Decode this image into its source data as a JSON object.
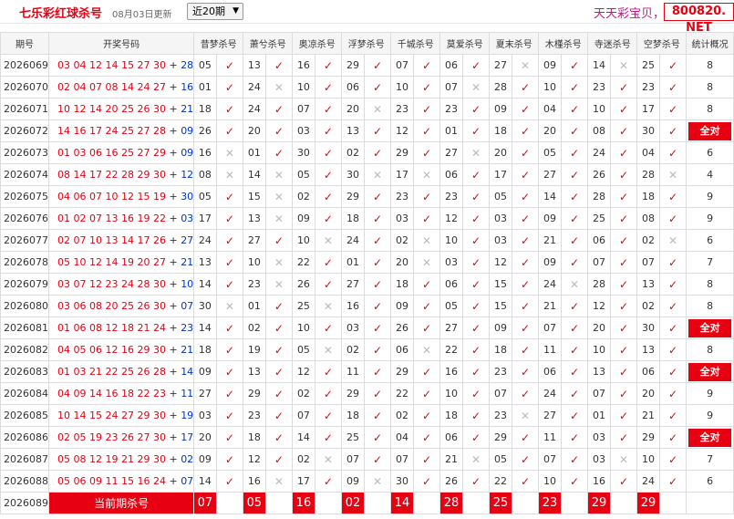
{
  "header": {
    "app_title": "七乐彩红球杀号",
    "date": "08月03日更新",
    "period_select": "近20期",
    "slogan": "天天彩宝贝，天",
    "site_badge": "800820. NET"
  },
  "columns": {
    "period": "期号",
    "draw": "开奖号码",
    "experts": [
      "昔梦杀号",
      "萧兮杀号",
      "奥凉杀号",
      "浮梦杀号",
      "千城杀号",
      "莫爱杀号",
      "夏末杀号",
      "木槿杀号",
      "寺迷杀号",
      "空梦杀号"
    ],
    "stat": "统计概况"
  },
  "rows": [
    {
      "period": "2026069",
      "red": "03 04 12 14 15 27 30",
      "blue": "28",
      "kills": [
        [
          "05",
          1
        ],
        [
          "13",
          1
        ],
        [
          "16",
          1
        ],
        [
          "29",
          1
        ],
        [
          "07",
          1
        ],
        [
          "06",
          1
        ],
        [
          "27",
          0
        ],
        [
          "09",
          1
        ],
        [
          "14",
          0
        ],
        [
          "25",
          1
        ]
      ],
      "stat": "8"
    },
    {
      "period": "2026070",
      "red": "02 04 07 08 14 24 27",
      "blue": "16",
      "kills": [
        [
          "01",
          1
        ],
        [
          "24",
          0
        ],
        [
          "10",
          1
        ],
        [
          "06",
          1
        ],
        [
          "10",
          1
        ],
        [
          "07",
          0
        ],
        [
          "28",
          1
        ],
        [
          "10",
          1
        ],
        [
          "23",
          1
        ],
        [
          "23",
          1
        ]
      ],
      "stat": "8"
    },
    {
      "period": "2026071",
      "red": "10 12 14 20 25 26 30",
      "blue": "21",
      "kills": [
        [
          "18",
          1
        ],
        [
          "24",
          1
        ],
        [
          "07",
          1
        ],
        [
          "20",
          0
        ],
        [
          "23",
          1
        ],
        [
          "23",
          1
        ],
        [
          "09",
          1
        ],
        [
          "04",
          1
        ],
        [
          "10",
          1
        ],
        [
          "17",
          1
        ]
      ],
      "stat": "8"
    },
    {
      "period": "2026072",
      "red": "14 16 17 24 25 27 28",
      "blue": "09",
      "kills": [
        [
          "26",
          1
        ],
        [
          "20",
          1
        ],
        [
          "03",
          1
        ],
        [
          "13",
          1
        ],
        [
          "12",
          1
        ],
        [
          "01",
          1
        ],
        [
          "18",
          1
        ],
        [
          "20",
          1
        ],
        [
          "08",
          1
        ],
        [
          "30",
          1
        ]
      ],
      "stat": "全对"
    },
    {
      "period": "2026073",
      "red": "01 03 06 16 25 27 29",
      "blue": "09",
      "kills": [
        [
          "16",
          0
        ],
        [
          "01",
          1
        ],
        [
          "30",
          1
        ],
        [
          "02",
          1
        ],
        [
          "29",
          1
        ],
        [
          "27",
          0
        ],
        [
          "20",
          1
        ],
        [
          "05",
          1
        ],
        [
          "24",
          1
        ],
        [
          "04",
          1
        ]
      ],
      "stat": "6"
    },
    {
      "period": "2026074",
      "red": "08 14 17 22 28 29 30",
      "blue": "12",
      "kills": [
        [
          "08",
          0
        ],
        [
          "14",
          0
        ],
        [
          "05",
          1
        ],
        [
          "30",
          0
        ],
        [
          "17",
          0
        ],
        [
          "06",
          1
        ],
        [
          "17",
          1
        ],
        [
          "27",
          1
        ],
        [
          "26",
          1
        ],
        [
          "28",
          0
        ]
      ],
      "stat": "4"
    },
    {
      "period": "2026075",
      "red": "04 06 07 10 12 15 19",
      "blue": "30",
      "kills": [
        [
          "05",
          1
        ],
        [
          "15",
          0
        ],
        [
          "02",
          1
        ],
        [
          "29",
          1
        ],
        [
          "23",
          1
        ],
        [
          "23",
          1
        ],
        [
          "05",
          1
        ],
        [
          "14",
          1
        ],
        [
          "28",
          1
        ],
        [
          "18",
          1
        ]
      ],
      "stat": "9"
    },
    {
      "period": "2026076",
      "red": "01 02 07 13 16 19 22",
      "blue": "03",
      "kills": [
        [
          "17",
          1
        ],
        [
          "13",
          0
        ],
        [
          "09",
          1
        ],
        [
          "18",
          1
        ],
        [
          "03",
          1
        ],
        [
          "12",
          1
        ],
        [
          "03",
          1
        ],
        [
          "09",
          1
        ],
        [
          "25",
          1
        ],
        [
          "08",
          1
        ]
      ],
      "stat": "9"
    },
    {
      "period": "2026077",
      "red": "02 07 10 13 14 17 26",
      "blue": "27",
      "kills": [
        [
          "24",
          1
        ],
        [
          "27",
          1
        ],
        [
          "10",
          0
        ],
        [
          "24",
          1
        ],
        [
          "02",
          0
        ],
        [
          "10",
          1
        ],
        [
          "03",
          1
        ],
        [
          "21",
          1
        ],
        [
          "06",
          1
        ],
        [
          "02",
          0
        ]
      ],
      "stat": "6"
    },
    {
      "period": "2026078",
      "red": "05 10 12 14 19 20 27",
      "blue": "21",
      "kills": [
        [
          "13",
          1
        ],
        [
          "10",
          0
        ],
        [
          "22",
          1
        ],
        [
          "01",
          1
        ],
        [
          "20",
          0
        ],
        [
          "03",
          1
        ],
        [
          "12",
          1
        ],
        [
          "09",
          1
        ],
        [
          "07",
          1
        ],
        [
          "07",
          1
        ]
      ],
      "stat": "7"
    },
    {
      "period": "2026079",
      "red": "03 07 12 23 24 28 30",
      "blue": "10",
      "kills": [
        [
          "14",
          1
        ],
        [
          "23",
          0
        ],
        [
          "26",
          1
        ],
        [
          "27",
          1
        ],
        [
          "18",
          1
        ],
        [
          "06",
          1
        ],
        [
          "15",
          1
        ],
        [
          "24",
          0
        ],
        [
          "28",
          1
        ],
        [
          "13",
          1
        ]
      ],
      "stat": "8"
    },
    {
      "period": "2026080",
      "red": "03 06 08 20 25 26 30",
      "blue": "07",
      "kills": [
        [
          "30",
          0
        ],
        [
          "01",
          1
        ],
        [
          "25",
          0
        ],
        [
          "16",
          1
        ],
        [
          "09",
          1
        ],
        [
          "05",
          1
        ],
        [
          "15",
          1
        ],
        [
          "21",
          1
        ],
        [
          "12",
          1
        ],
        [
          "02",
          1
        ]
      ],
      "stat": "8"
    },
    {
      "period": "2026081",
      "red": "01 06 08 12 18 21 24",
      "blue": "23",
      "kills": [
        [
          "14",
          1
        ],
        [
          "02",
          1
        ],
        [
          "10",
          1
        ],
        [
          "03",
          1
        ],
        [
          "26",
          1
        ],
        [
          "27",
          1
        ],
        [
          "09",
          1
        ],
        [
          "07",
          1
        ],
        [
          "20",
          1
        ],
        [
          "30",
          1
        ]
      ],
      "stat": "全对"
    },
    {
      "period": "2026082",
      "red": "04 05 06 12 16 29 30",
      "blue": "21",
      "kills": [
        [
          "18",
          1
        ],
        [
          "19",
          1
        ],
        [
          "05",
          0
        ],
        [
          "02",
          1
        ],
        [
          "06",
          0
        ],
        [
          "22",
          1
        ],
        [
          "18",
          1
        ],
        [
          "11",
          1
        ],
        [
          "10",
          1
        ],
        [
          "13",
          1
        ]
      ],
      "stat": "8"
    },
    {
      "period": "2026083",
      "red": "01 03 21 22 25 26 28",
      "blue": "14",
      "kills": [
        [
          "09",
          1
        ],
        [
          "13",
          1
        ],
        [
          "12",
          1
        ],
        [
          "11",
          1
        ],
        [
          "29",
          1
        ],
        [
          "16",
          1
        ],
        [
          "23",
          1
        ],
        [
          "06",
          1
        ],
        [
          "13",
          1
        ],
        [
          "06",
          1
        ]
      ],
      "stat": "全对"
    },
    {
      "period": "2026084",
      "red": "04 09 14 16 18 22 23",
      "blue": "11",
      "kills": [
        [
          "27",
          1
        ],
        [
          "29",
          1
        ],
        [
          "02",
          1
        ],
        [
          "29",
          1
        ],
        [
          "22",
          1
        ],
        [
          "10",
          1
        ],
        [
          "07",
          1
        ],
        [
          "24",
          1
        ],
        [
          "07",
          1
        ],
        [
          "20",
          1
        ]
      ],
      "stat": "9"
    },
    {
      "period": "2026085",
      "red": "10 14 15 24 27 29 30",
      "blue": "19",
      "kills": [
        [
          "03",
          1
        ],
        [
          "23",
          1
        ],
        [
          "07",
          1
        ],
        [
          "18",
          1
        ],
        [
          "02",
          1
        ],
        [
          "18",
          1
        ],
        [
          "23",
          0
        ],
        [
          "27",
          1
        ],
        [
          "01",
          1
        ],
        [
          "21",
          1
        ]
      ],
      "stat": "9"
    },
    {
      "period": "2026086",
      "red": "02 05 19 23 26 27 30",
      "blue": "17",
      "kills": [
        [
          "20",
          1
        ],
        [
          "18",
          1
        ],
        [
          "14",
          1
        ],
        [
          "25",
          1
        ],
        [
          "04",
          1
        ],
        [
          "06",
          1
        ],
        [
          "29",
          1
        ],
        [
          "11",
          1
        ],
        [
          "03",
          1
        ],
        [
          "29",
          1
        ]
      ],
      "stat": "全对"
    },
    {
      "period": "2026087",
      "red": "05 08 12 19 21 29 30",
      "blue": "02",
      "kills": [
        [
          "09",
          1
        ],
        [
          "12",
          1
        ],
        [
          "02",
          0
        ],
        [
          "07",
          1
        ],
        [
          "07",
          1
        ],
        [
          "21",
          0
        ],
        [
          "05",
          1
        ],
        [
          "07",
          1
        ],
        [
          "03",
          0
        ],
        [
          "10",
          1
        ]
      ],
      "stat": "7"
    },
    {
      "period": "2026088",
      "red": "05 06 09 11 15 16 24",
      "blue": "07",
      "kills": [
        [
          "14",
          1
        ],
        [
          "16",
          0
        ],
        [
          "17",
          1
        ],
        [
          "09",
          0
        ],
        [
          "30",
          1
        ],
        [
          "26",
          1
        ],
        [
          "22",
          1
        ],
        [
          "10",
          1
        ],
        [
          "16",
          1
        ],
        [
          "24",
          1
        ]
      ],
      "stat": "6"
    }
  ],
  "current": {
    "period": "2026089",
    "label": "当前期杀号",
    "numbers": [
      "07",
      "05",
      "16",
      "02",
      "14",
      "28",
      "25",
      "23",
      "29",
      "29"
    ]
  },
  "symbols": {
    "hit": "✓",
    "miss": "✕",
    "plus": "+"
  },
  "colors": {
    "accent": "#e60012",
    "blue_ball": "#0033cc",
    "header_bg": "#f5f5f5"
  }
}
